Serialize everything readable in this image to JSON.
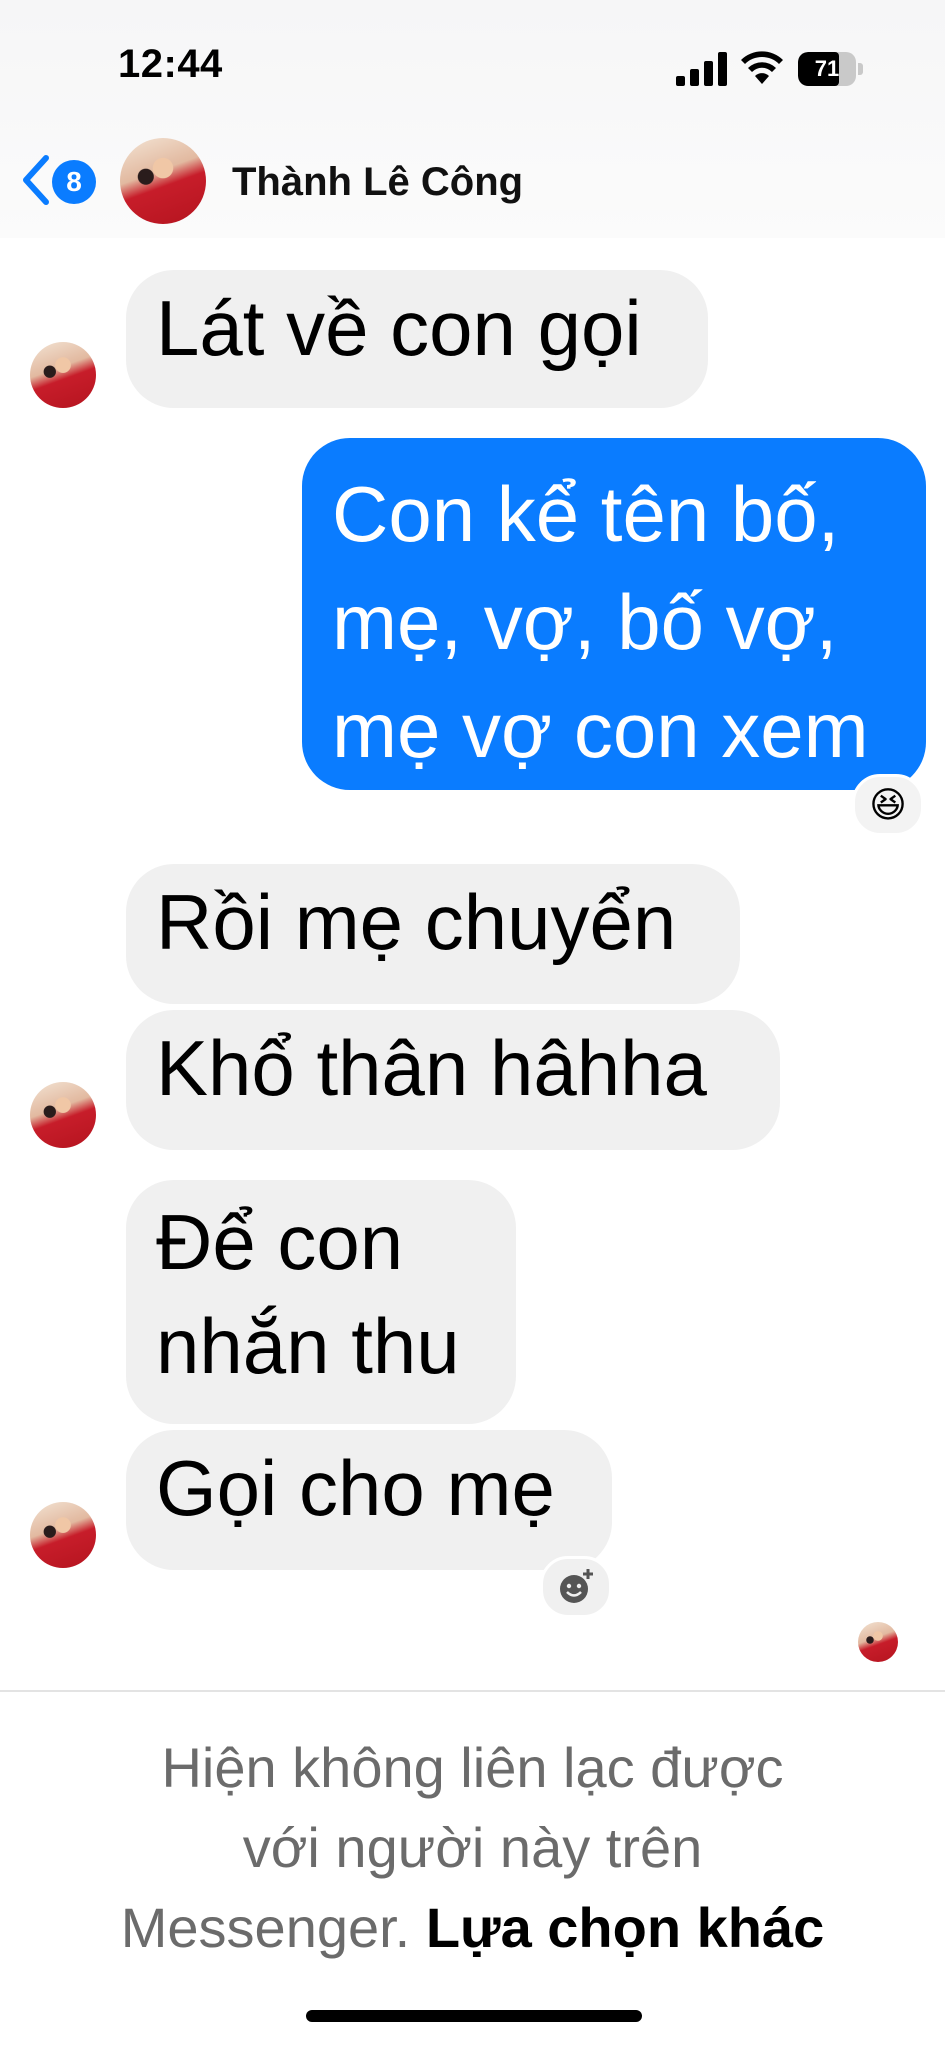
{
  "status_bar": {
    "time": "12:44",
    "battery": "71",
    "battery_level": 0.71
  },
  "header": {
    "unread_count": "8",
    "contact_name": "Thành Lê Công"
  },
  "messages": [
    {
      "direction": "in",
      "text": "Lát về con gọi"
    },
    {
      "direction": "out",
      "lines": [
        "Con kể tên bố,",
        "mẹ, vợ, bố vợ,",
        "mẹ vợ con xem"
      ],
      "reaction": "😆"
    },
    {
      "direction": "in",
      "text": "Rồi mẹ chuyển"
    },
    {
      "direction": "in",
      "text": "Khổ thân hâhha"
    },
    {
      "direction": "in",
      "lines": [
        "Để con",
        "nhắn thu"
      ]
    },
    {
      "direction": "in",
      "text": "Gọi cho mẹ",
      "reaction_icon": "add-reaction-icon"
    }
  ],
  "footer": {
    "notice_line1": "Hiện không liên lạc được",
    "notice_line2": "với người này trên",
    "notice_line3": "Messenger.",
    "notice_link": "Lựa chọn khác"
  },
  "colors": {
    "accent": "#0a7cff",
    "incoming_bubble": "#f0f0f0",
    "notice_text": "#6b6b6b"
  }
}
